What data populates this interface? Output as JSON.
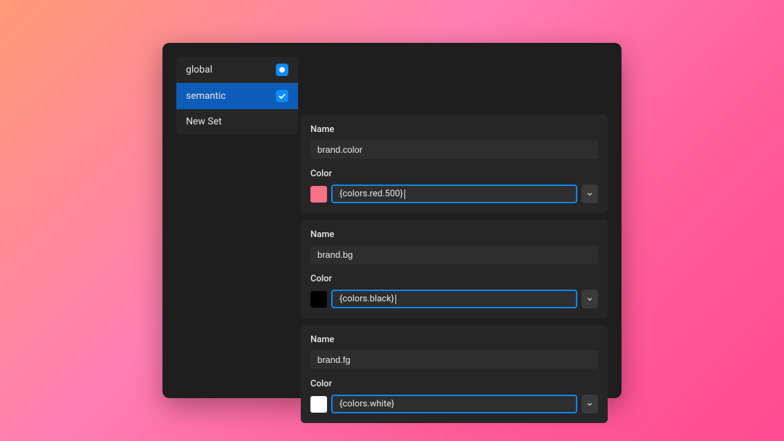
{
  "sidebar": {
    "items": [
      {
        "label": "global",
        "status": "partial",
        "selected": false
      },
      {
        "label": "semantic",
        "status": "checked",
        "selected": true
      },
      {
        "label": "New Set",
        "status": "none",
        "selected": false
      }
    ]
  },
  "tokens": [
    {
      "name_label": "Name",
      "name_value": "brand.color",
      "color_label": "Color",
      "color_value": "{colors.red.500}",
      "swatch_hex": "#fb7185",
      "has_cursor": true
    },
    {
      "name_label": "Name",
      "name_value": "brand.bg",
      "color_label": "Color",
      "color_value": "{colors.black}",
      "swatch_hex": "#000000",
      "has_cursor": true
    },
    {
      "name_label": "Name",
      "name_value": "brand.fg",
      "color_label": "Color",
      "color_value": "{colors.white}",
      "swatch_hex": "#ffffff",
      "has_cursor": false
    }
  ],
  "colors": {
    "accent": "#0d8bff",
    "panel_bg": "#1e1e1e",
    "card_bg": "#262626",
    "input_bg": "#2e2e2e"
  }
}
